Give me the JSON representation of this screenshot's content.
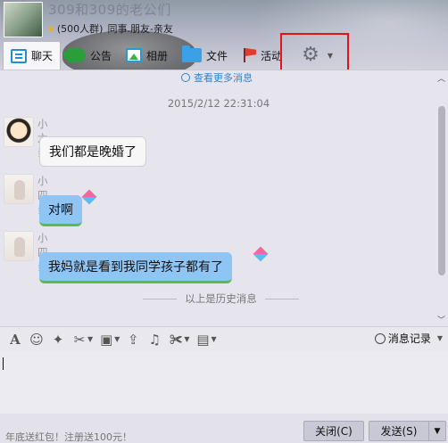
{
  "header": {
    "group_name": "309和309的老公们",
    "group_member_count": "(500人群)",
    "group_category": "同事.朋友-亲友"
  },
  "toolbar": {
    "tabs": [
      {
        "label": "聊天",
        "icon": "chat-icon"
      },
      {
        "label": "公告",
        "icon": "announcement-icon"
      },
      {
        "label": "相册",
        "icon": "album-icon"
      },
      {
        "label": "文件",
        "icon": "folder-icon"
      },
      {
        "label": "活动",
        "icon": "flag-icon"
      }
    ],
    "settings_icon": "gear-icon"
  },
  "chat": {
    "view_more": "查看更多消息",
    "timestamp": "2015/2/12 22:31:04",
    "messages": [
      {
        "sender": "小六亲",
        "text": "我们都是晚婚了",
        "style": "white"
      },
      {
        "sender": "小四亲",
        "text": "对啊",
        "style": "blue"
      },
      {
        "sender": "小四亲",
        "text": "我妈就是看到我同学孩子都有了",
        "style": "blue"
      }
    ],
    "history_divider": "以上是历史消息"
  },
  "input_toolbar": {
    "icons": [
      "font-icon",
      "emoji-icon",
      "magic-icon",
      "screenshot-icon",
      "image-icon",
      "upload-icon",
      "music-icon",
      "scissors-icon",
      "more-icon"
    ],
    "history_label": "消息记录"
  },
  "footer": {
    "ad_text": "年底送红包！注册送100元！",
    "close_label": "关闭(C)",
    "send_label": "发送(S)"
  },
  "colors": {
    "highlight": "#e0141b",
    "bubble_blue": "#8fc5f5",
    "link_blue": "#2e83cf"
  }
}
